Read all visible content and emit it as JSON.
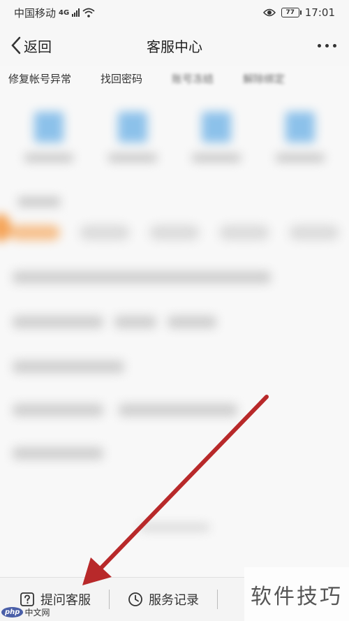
{
  "status_bar": {
    "carrier": "中国移动",
    "network": "4G",
    "battery": "77",
    "time": "17:01"
  },
  "nav": {
    "back_label": "返回",
    "title": "客服中心"
  },
  "tabs": [
    {
      "label": "修复帐号异常"
    },
    {
      "label": "找回密码"
    },
    {
      "label": "账号冻结"
    },
    {
      "label": "解除绑定"
    }
  ],
  "bottom_bar": {
    "ask_label": "提问客服",
    "records_label": "服务记录"
  },
  "watermark": {
    "text": "软件技巧",
    "logo_badge": "php",
    "logo_text": "中文网"
  },
  "colors": {
    "annotation_arrow": "#b8292a",
    "accent_orange": "#f5a55a"
  }
}
